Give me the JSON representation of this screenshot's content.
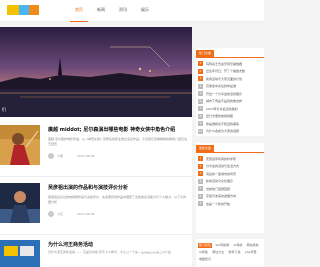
{
  "header": {
    "nav": [
      {
        "label": "首页",
        "active": true
      },
      {
        "label": "新闻"
      },
      {
        "label": "资讯"
      },
      {
        "label": "娱乐"
      }
    ]
  },
  "hero": {
    "caption": "们"
  },
  "articles": [
    {
      "title": "廣越 middot; 尼尔森演出哪些电影 神奇女侠中角色介绍",
      "excerpt": "廣越 尼尔森的电影作品：从《神奇女侠》到著名的职业舞台演出作品，今天我们来看看她的角色介绍及演艺经历",
      "author": "小明",
      "date": "2023-06-08"
    },
    {
      "title": "吴彦祖出演的作品和与演技评价分析",
      "excerpt": "吴彦祖出演过的电视剧作品与演技评价，在多部影视作品中展现了出色的表演能力与个人魅力，以下为详细分析",
      "author": "小红",
      "date": "2023-06-08"
    }
  ],
  "article_bottom": {
    "title": "为什么河王商务活动",
    "excerpt": "为什么河王商务活动 —— 它是分享会 有不少人参与，今天为一个多人活动展示的信息与介绍"
  },
  "sidebar": {
    "panel1": {
      "tag": "热门文章",
      "items": [
        "吗刺杀王式蓝牙音乐播放器",
        "出生年月日，开了个播放次数",
        "新春活动与大家见面的计划",
        "高乘坐中关注的你是谁",
        "开出一个分享会的活动展示",
        "城市下雪是不是真的像这样",
        "2023年分享会活动策划",
        "出行方便的地铁线路",
        "你是谁我也不知道的事情",
        "为什么会成为大家的话题"
      ]
    },
    "panel2": {
      "tag": "最新文章",
      "items": [
        "安装最早时间的科学家",
        "分享会的活动与生活方式",
        "海边的一座城市的风景",
        "新春活动与文化展示",
        "当前热门话题回顾",
        "宇宙与未来的发展方向",
        "这是一个新的开始"
      ]
    },
    "tags": [
      "热门标签",
      "4AI导航网",
      "Ai导航",
      "网站导航",
      "AI导航",
      "网址大全",
      "软件下载",
      "php手册",
      "电脑知识",
      "网络",
      "教程",
      "资源",
      "更多"
    ]
  },
  "watermark": {
    "text": "天空资源"
  }
}
